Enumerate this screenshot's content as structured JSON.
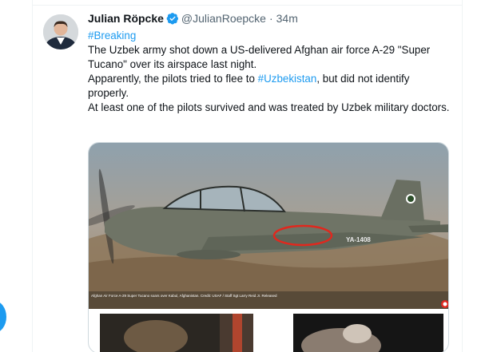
{
  "tweet": {
    "author_name": "Julian Röpcke",
    "handle": "@JulianRoepcke",
    "separator": "·",
    "time": "34m",
    "verified_icon": "verified-badge-icon",
    "hashtag_breaking": "#Breaking",
    "line1": "The Uzbek army shot down a US-delivered Afghan air force A-29 \"Super Tucano\" over its airspace last night.",
    "line2_prefix": "Apparently, the pilots tried to flee to ",
    "hashtag_uzbekistan": "#Uzbekistan",
    "line2_suffix": ", but did not identify properly.",
    "line3": "At least one of the pilots survived and was treated by Uzbek military doctors."
  },
  "media": {
    "aircraft_tail_code": "YA-1408",
    "photo_caption": "Afghan Air Force A-29 Super Tucano soars over Kabul, Afghanistan. Credit: USAF / Staff Sgt Larry Reid Jr. Released"
  },
  "colors": {
    "accent": "#1d9bf0",
    "annotation_circle": "#e0281e"
  }
}
